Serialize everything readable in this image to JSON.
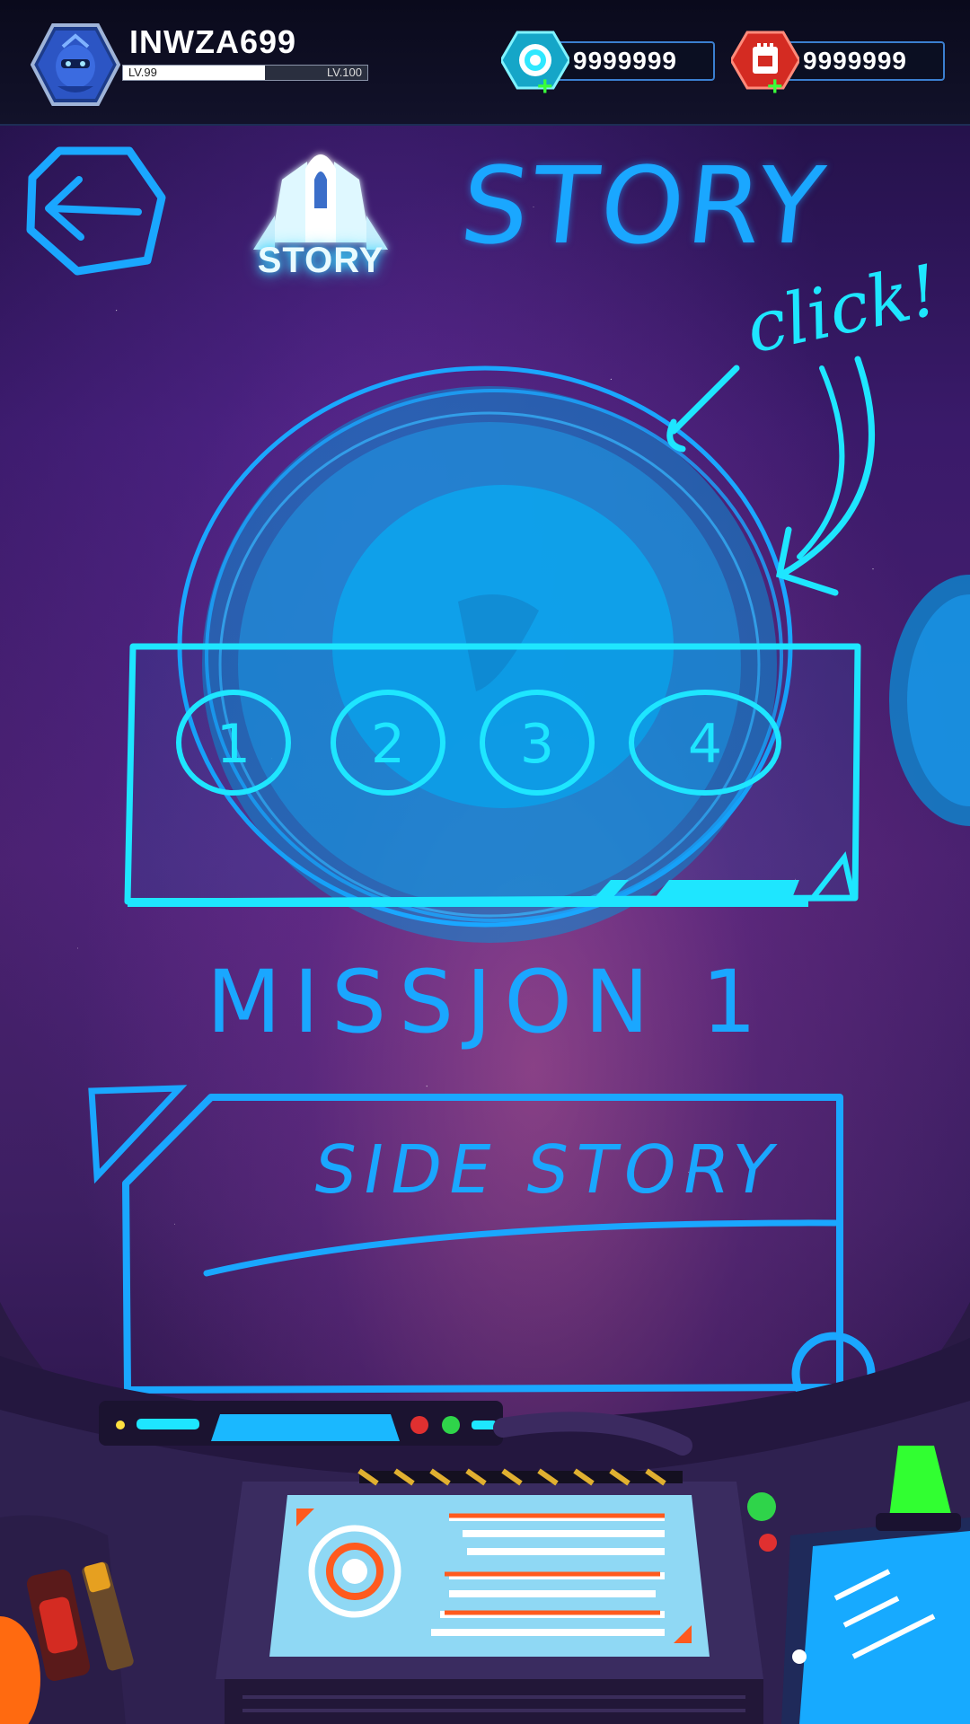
{
  "player": {
    "name": "INWZA699",
    "level_current": "LV.99",
    "level_next": "LV.100",
    "xp_progress": 0.58
  },
  "currencies": [
    {
      "name": "crystal",
      "amount": "9999999",
      "icon": "cyan-crystal-icon",
      "color": "#2fe8ff"
    },
    {
      "name": "ticket",
      "amount": "9999999",
      "icon": "red-ticket-icon",
      "color": "#f0392b"
    }
  ],
  "header": {
    "badge_label": "STORY",
    "title": "STORY",
    "annotation": "click!"
  },
  "chapters": [
    {
      "label": "1"
    },
    {
      "label": "2"
    },
    {
      "label": "3"
    },
    {
      "label": "4"
    }
  ],
  "mission": {
    "title": "MISSJON 1"
  },
  "side_story": {
    "label": "SIDE STORY"
  },
  "colors": {
    "sketch_cyan": "#1ee6ff",
    "sketch_blue": "#1aa7ff",
    "planet_blue": "#0aa8f0"
  }
}
